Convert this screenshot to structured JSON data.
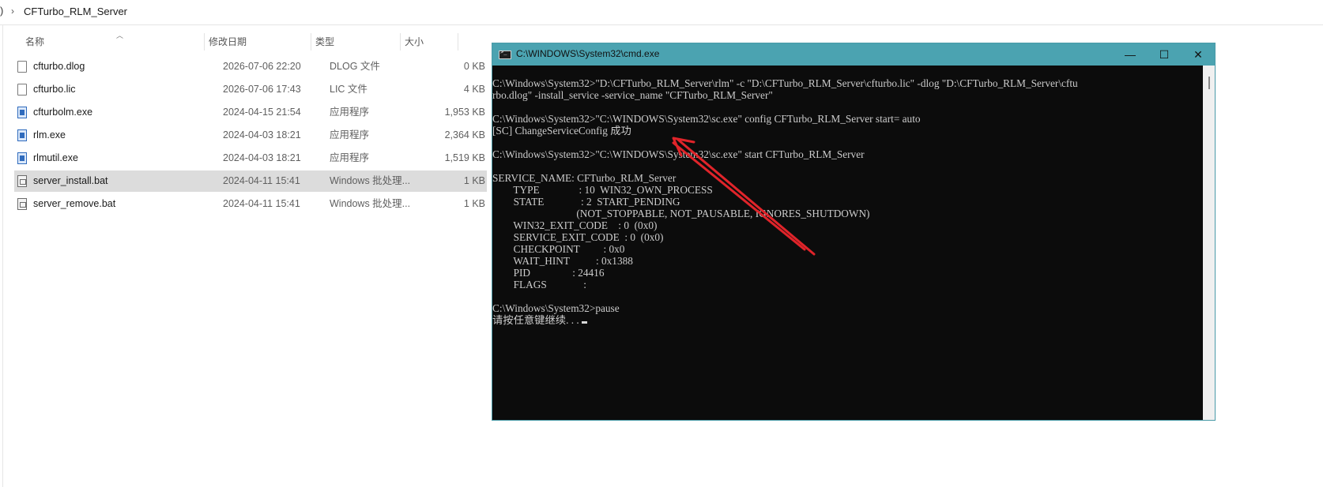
{
  "breadcrumb": {
    "edge": ")",
    "separator": "›",
    "current": "CFTurbo_RLM_Server"
  },
  "columns": {
    "name": "名称",
    "modified": "修改日期",
    "type": "类型",
    "size": "大小"
  },
  "files": [
    {
      "name": "cfturbo.dlog",
      "modified": "2026-07-06 22:20",
      "type": "DLOG 文件",
      "size": "0 KB",
      "icon": "document-icon"
    },
    {
      "name": "cfturbo.lic",
      "modified": "2026-07-06 17:43",
      "type": "LIC 文件",
      "size": "4 KB",
      "icon": "document-icon"
    },
    {
      "name": "cfturbolm.exe",
      "modified": "2024-04-15 21:54",
      "type": "应用程序",
      "size": "1,953 KB",
      "icon": "exe-icon"
    },
    {
      "name": "rlm.exe",
      "modified": "2024-04-03 18:21",
      "type": "应用程序",
      "size": "2,364 KB",
      "icon": "exe-icon"
    },
    {
      "name": "rlmutil.exe",
      "modified": "2024-04-03 18:21",
      "type": "应用程序",
      "size": "1,519 KB",
      "icon": "exe-icon"
    },
    {
      "name": "server_install.bat",
      "modified": "2024-04-11 15:41",
      "type": "Windows 批处理...",
      "size": "1 KB",
      "icon": "batch-icon",
      "selected": true
    },
    {
      "name": "server_remove.bat",
      "modified": "2024-04-11 15:41",
      "type": "Windows 批处理...",
      "size": "1 KB",
      "icon": "batch-icon"
    }
  ],
  "cmd": {
    "title": "C:\\WINDOWS\\System32\\cmd.exe",
    "controls": {
      "minimize": "—",
      "maximize": "☐",
      "close": "✕"
    },
    "lines": [
      "C:\\Windows\\System32>\"D:\\CFTurbo_RLM_Server\\rlm\" -c \"D:\\CFTurbo_RLM_Server\\cfturbo.lic\" -dlog \"D:\\CFTurbo_RLM_Server\\cftu",
      "rbo.dlog\" -install_service -service_name \"CFTurbo_RLM_Server\"",
      "",
      "C:\\Windows\\System32>\"C:\\WINDOWS\\System32\\sc.exe\" config CFTurbo_RLM_Server start= auto",
      "[SC] ChangeServiceConfig 成功",
      "",
      "C:\\Windows\\System32>\"C:\\WINDOWS\\System32\\sc.exe\" start CFTurbo_RLM_Server",
      "",
      "SERVICE_NAME: CFTurbo_RLM_Server",
      "        TYPE               : 10  WIN32_OWN_PROCESS",
      "        STATE              : 2  START_PENDING",
      "                                (NOT_STOPPABLE, NOT_PAUSABLE, IGNORES_SHUTDOWN)",
      "        WIN32_EXIT_CODE    : 0  (0x0)",
      "        SERVICE_EXIT_CODE  : 0  (0x0)",
      "        CHECKPOINT         : 0x0",
      "        WAIT_HINT          : 0x1388",
      "        PID                : 24416",
      "        FLAGS              :",
      "",
      "C:\\Windows\\System32>pause",
      "请按任意键继续. . ."
    ]
  },
  "annotation": {
    "color": "#e0242a"
  }
}
